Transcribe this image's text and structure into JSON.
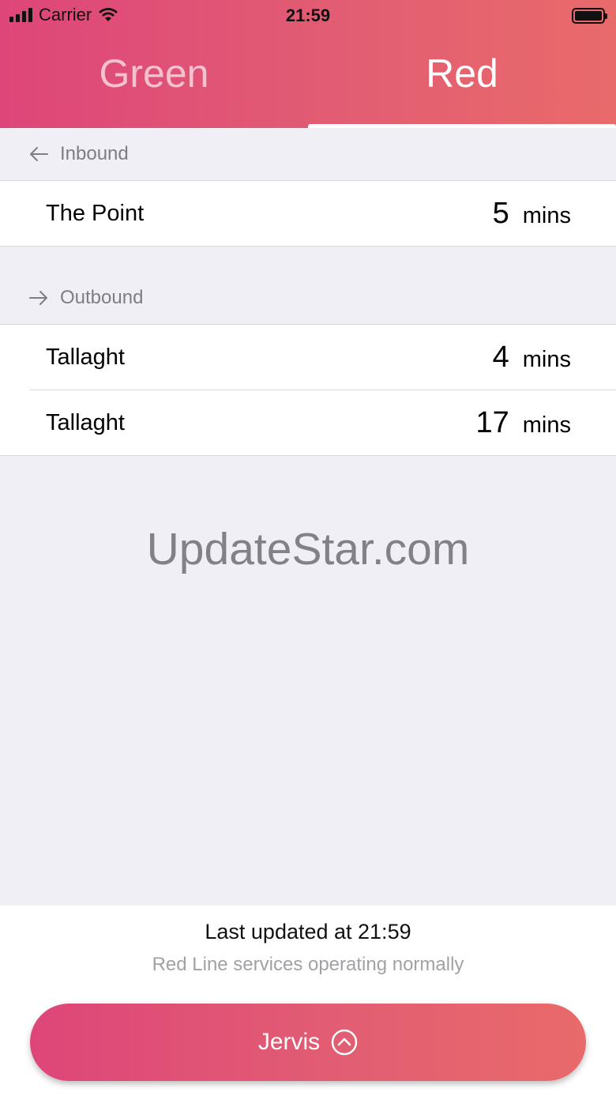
{
  "status_bar": {
    "carrier": "Carrier",
    "time": "21:59"
  },
  "tabs": [
    {
      "label": "Green",
      "selected": false
    },
    {
      "label": "Red",
      "selected": true
    }
  ],
  "inbound": {
    "label": "Inbound",
    "icon": "arrow-left-icon",
    "rows": [
      {
        "destination": "The Point",
        "minutes": "5",
        "unit": "mins"
      }
    ]
  },
  "outbound": {
    "label": "Outbound",
    "icon": "arrow-right-icon",
    "rows": [
      {
        "destination": "Tallaght",
        "minutes": "4",
        "unit": "mins"
      },
      {
        "destination": "Tallaght",
        "minutes": "17",
        "unit": "mins"
      }
    ]
  },
  "watermark": "UpdateStar.com",
  "footer": {
    "last_updated": "Last updated at 21:59",
    "service_status": "Red Line services operating normally",
    "stop_label": "Jervis",
    "stop_icon": "chevron-up-circle-icon"
  },
  "colors": {
    "gradient_start": "#de4679",
    "gradient_end": "#e96a6a",
    "background": "#f0eff5",
    "secondary_text": "#7d7d83"
  }
}
